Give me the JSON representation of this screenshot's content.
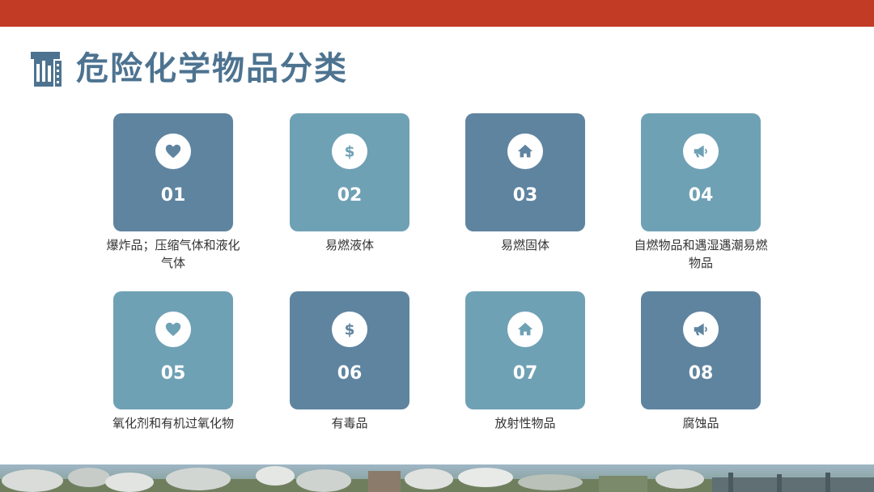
{
  "header": {
    "title": "危险化学物品分类",
    "accent_color": "#c23b25",
    "title_color": "#4d7390"
  },
  "palette": {
    "dark": "#5f84a0",
    "light": "#6fa1b5"
  },
  "categories": [
    {
      "number": "01",
      "label": "爆炸品；压缩气体和液化气体",
      "icon": "heart-icon"
    },
    {
      "number": "02",
      "label": "易燃液体",
      "icon": "dollar-icon"
    },
    {
      "number": "03",
      "label": "易燃固体",
      "icon": "home-icon"
    },
    {
      "number": "04",
      "label": "自燃物品和遇湿遇潮易燃物品",
      "icon": "megaphone-icon"
    },
    {
      "number": "05",
      "label": "氧化剂和有机过氧化物",
      "icon": "heart-icon"
    },
    {
      "number": "06",
      "label": "有毒品",
      "icon": "dollar-icon"
    },
    {
      "number": "07",
      "label": "放射性物品",
      "icon": "home-icon"
    },
    {
      "number": "08",
      "label": "腐蚀品",
      "icon": "megaphone-icon"
    }
  ]
}
